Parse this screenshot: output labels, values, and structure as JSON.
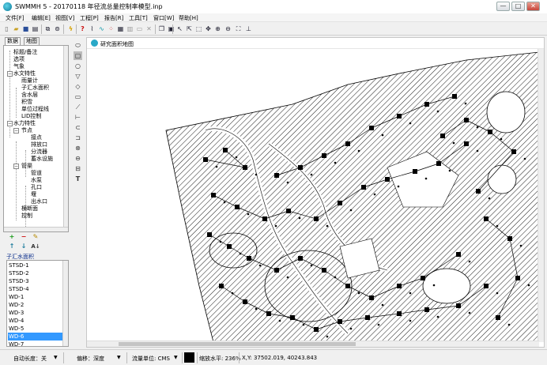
{
  "window": {
    "title": "SWMMH 5 - 20170118 年径流总量控制率模型.inp",
    "controls": {
      "minimize": "—",
      "maximize": "□",
      "close": "✕"
    }
  },
  "menu": [
    "文件[F]",
    "编辑[E]",
    "视图[V]",
    "工程[P]",
    "报告[R]",
    "工具[T]",
    "窗口[W]",
    "帮助[H]"
  ],
  "toolbar_icons": [
    "new-icon",
    "open-icon",
    "save-icon",
    "print-icon",
    "copy-icon",
    "find-icon",
    "query-icon",
    "help-icon",
    "run-icon",
    "profile-plot-icon",
    "time-plot-icon",
    "scatter-plot-icon",
    "table-icon",
    "statistics-icon",
    "report-icon",
    "options-icon",
    "close-all-icon",
    "cascade-icon",
    "tile-icon"
  ],
  "draw_tools": [
    "select-tool-icon",
    "vertex-tool-icon",
    "select-region-icon",
    "pan-icon",
    "zoom-in-icon",
    "zoom-out-icon",
    "full-extent-icon",
    "measure-icon"
  ],
  "left_panel": {
    "tabs": [
      "数据",
      "地图"
    ],
    "tree": [
      {
        "label": "标题/备注"
      },
      {
        "label": "选项"
      },
      {
        "label": "气象"
      },
      {
        "label": "水文特性"
      },
      {
        "label": "雨量计"
      },
      {
        "label": "子汇水面积"
      },
      {
        "label": "含水层"
      },
      {
        "label": "积雪"
      },
      {
        "label": "单位过程线"
      },
      {
        "label": "LID控制"
      },
      {
        "label": "水力特性"
      },
      {
        "label": "节点"
      },
      {
        "label": "接点"
      },
      {
        "label": "排放口"
      },
      {
        "label": "分流器"
      },
      {
        "label": "蓄水设施"
      },
      {
        "label": "管渠"
      },
      {
        "label": "管道"
      },
      {
        "label": "水泵"
      },
      {
        "label": "孔口"
      },
      {
        "label": "堰"
      },
      {
        "label": "出水口"
      },
      {
        "label": "横断面"
      },
      {
        "label": "控制"
      }
    ],
    "buttons_row1": [
      "+",
      "−",
      "✎"
    ],
    "buttons_row2": [
      "↑",
      "↓",
      "A↓"
    ],
    "list_label": "子汇水面积",
    "list_items": [
      "STSD-1",
      "STSD-2",
      "STSD-3",
      "STSD-4",
      "WD-1",
      "WD-2",
      "WD-3",
      "WD-4",
      "WD-5",
      "WD-6",
      "WD-7"
    ],
    "list_selected": "WD-6"
  },
  "map_window": {
    "title": "研究面积地图"
  },
  "statusbar": {
    "auto_length": "自动长度：关",
    "offsets": "偏移：深度",
    "flow_units": "流量单位: CMS",
    "zoom": "缩放水平: 236%",
    "xy": "X,Y: 37502.019, 40243.843"
  },
  "colors": {
    "selection": "#3399ff",
    "list_label": "#0a2d8a",
    "hatch": "#000000",
    "map_background": "#ffffff"
  }
}
